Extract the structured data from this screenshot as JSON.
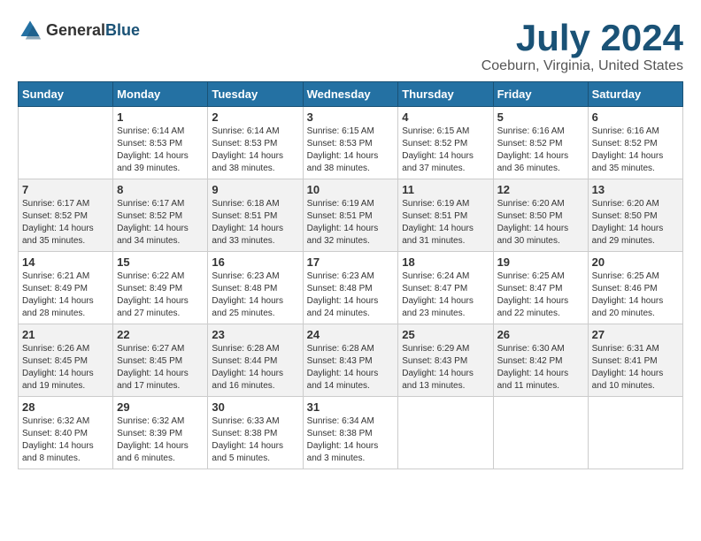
{
  "header": {
    "logo_general": "General",
    "logo_blue": "Blue",
    "title": "July 2024",
    "subtitle": "Coeburn, Virginia, United States"
  },
  "calendar": {
    "columns": [
      "Sunday",
      "Monday",
      "Tuesday",
      "Wednesday",
      "Thursday",
      "Friday",
      "Saturday"
    ],
    "weeks": [
      [
        {
          "day": "",
          "sunrise": "",
          "sunset": "",
          "daylight": ""
        },
        {
          "day": "1",
          "sunrise": "Sunrise: 6:14 AM",
          "sunset": "Sunset: 8:53 PM",
          "daylight": "Daylight: 14 hours and 39 minutes."
        },
        {
          "day": "2",
          "sunrise": "Sunrise: 6:14 AM",
          "sunset": "Sunset: 8:53 PM",
          "daylight": "Daylight: 14 hours and 38 minutes."
        },
        {
          "day": "3",
          "sunrise": "Sunrise: 6:15 AM",
          "sunset": "Sunset: 8:53 PM",
          "daylight": "Daylight: 14 hours and 38 minutes."
        },
        {
          "day": "4",
          "sunrise": "Sunrise: 6:15 AM",
          "sunset": "Sunset: 8:52 PM",
          "daylight": "Daylight: 14 hours and 37 minutes."
        },
        {
          "day": "5",
          "sunrise": "Sunrise: 6:16 AM",
          "sunset": "Sunset: 8:52 PM",
          "daylight": "Daylight: 14 hours and 36 minutes."
        },
        {
          "day": "6",
          "sunrise": "Sunrise: 6:16 AM",
          "sunset": "Sunset: 8:52 PM",
          "daylight": "Daylight: 14 hours and 35 minutes."
        }
      ],
      [
        {
          "day": "7",
          "sunrise": "Sunrise: 6:17 AM",
          "sunset": "Sunset: 8:52 PM",
          "daylight": "Daylight: 14 hours and 35 minutes."
        },
        {
          "day": "8",
          "sunrise": "Sunrise: 6:17 AM",
          "sunset": "Sunset: 8:52 PM",
          "daylight": "Daylight: 14 hours and 34 minutes."
        },
        {
          "day": "9",
          "sunrise": "Sunrise: 6:18 AM",
          "sunset": "Sunset: 8:51 PM",
          "daylight": "Daylight: 14 hours and 33 minutes."
        },
        {
          "day": "10",
          "sunrise": "Sunrise: 6:19 AM",
          "sunset": "Sunset: 8:51 PM",
          "daylight": "Daylight: 14 hours and 32 minutes."
        },
        {
          "day": "11",
          "sunrise": "Sunrise: 6:19 AM",
          "sunset": "Sunset: 8:51 PM",
          "daylight": "Daylight: 14 hours and 31 minutes."
        },
        {
          "day": "12",
          "sunrise": "Sunrise: 6:20 AM",
          "sunset": "Sunset: 8:50 PM",
          "daylight": "Daylight: 14 hours and 30 minutes."
        },
        {
          "day": "13",
          "sunrise": "Sunrise: 6:20 AM",
          "sunset": "Sunset: 8:50 PM",
          "daylight": "Daylight: 14 hours and 29 minutes."
        }
      ],
      [
        {
          "day": "14",
          "sunrise": "Sunrise: 6:21 AM",
          "sunset": "Sunset: 8:49 PM",
          "daylight": "Daylight: 14 hours and 28 minutes."
        },
        {
          "day": "15",
          "sunrise": "Sunrise: 6:22 AM",
          "sunset": "Sunset: 8:49 PM",
          "daylight": "Daylight: 14 hours and 27 minutes."
        },
        {
          "day": "16",
          "sunrise": "Sunrise: 6:23 AM",
          "sunset": "Sunset: 8:48 PM",
          "daylight": "Daylight: 14 hours and 25 minutes."
        },
        {
          "day": "17",
          "sunrise": "Sunrise: 6:23 AM",
          "sunset": "Sunset: 8:48 PM",
          "daylight": "Daylight: 14 hours and 24 minutes."
        },
        {
          "day": "18",
          "sunrise": "Sunrise: 6:24 AM",
          "sunset": "Sunset: 8:47 PM",
          "daylight": "Daylight: 14 hours and 23 minutes."
        },
        {
          "day": "19",
          "sunrise": "Sunrise: 6:25 AM",
          "sunset": "Sunset: 8:47 PM",
          "daylight": "Daylight: 14 hours and 22 minutes."
        },
        {
          "day": "20",
          "sunrise": "Sunrise: 6:25 AM",
          "sunset": "Sunset: 8:46 PM",
          "daylight": "Daylight: 14 hours and 20 minutes."
        }
      ],
      [
        {
          "day": "21",
          "sunrise": "Sunrise: 6:26 AM",
          "sunset": "Sunset: 8:45 PM",
          "daylight": "Daylight: 14 hours and 19 minutes."
        },
        {
          "day": "22",
          "sunrise": "Sunrise: 6:27 AM",
          "sunset": "Sunset: 8:45 PM",
          "daylight": "Daylight: 14 hours and 17 minutes."
        },
        {
          "day": "23",
          "sunrise": "Sunrise: 6:28 AM",
          "sunset": "Sunset: 8:44 PM",
          "daylight": "Daylight: 14 hours and 16 minutes."
        },
        {
          "day": "24",
          "sunrise": "Sunrise: 6:28 AM",
          "sunset": "Sunset: 8:43 PM",
          "daylight": "Daylight: 14 hours and 14 minutes."
        },
        {
          "day": "25",
          "sunrise": "Sunrise: 6:29 AM",
          "sunset": "Sunset: 8:43 PM",
          "daylight": "Daylight: 14 hours and 13 minutes."
        },
        {
          "day": "26",
          "sunrise": "Sunrise: 6:30 AM",
          "sunset": "Sunset: 8:42 PM",
          "daylight": "Daylight: 14 hours and 11 minutes."
        },
        {
          "day": "27",
          "sunrise": "Sunrise: 6:31 AM",
          "sunset": "Sunset: 8:41 PM",
          "daylight": "Daylight: 14 hours and 10 minutes."
        }
      ],
      [
        {
          "day": "28",
          "sunrise": "Sunrise: 6:32 AM",
          "sunset": "Sunset: 8:40 PM",
          "daylight": "Daylight: 14 hours and 8 minutes."
        },
        {
          "day": "29",
          "sunrise": "Sunrise: 6:32 AM",
          "sunset": "Sunset: 8:39 PM",
          "daylight": "Daylight: 14 hours and 6 minutes."
        },
        {
          "day": "30",
          "sunrise": "Sunrise: 6:33 AM",
          "sunset": "Sunset: 8:38 PM",
          "daylight": "Daylight: 14 hours and 5 minutes."
        },
        {
          "day": "31",
          "sunrise": "Sunrise: 6:34 AM",
          "sunset": "Sunset: 8:38 PM",
          "daylight": "Daylight: 14 hours and 3 minutes."
        },
        {
          "day": "",
          "sunrise": "",
          "sunset": "",
          "daylight": ""
        },
        {
          "day": "",
          "sunrise": "",
          "sunset": "",
          "daylight": ""
        },
        {
          "day": "",
          "sunrise": "",
          "sunset": "",
          "daylight": ""
        }
      ]
    ]
  }
}
